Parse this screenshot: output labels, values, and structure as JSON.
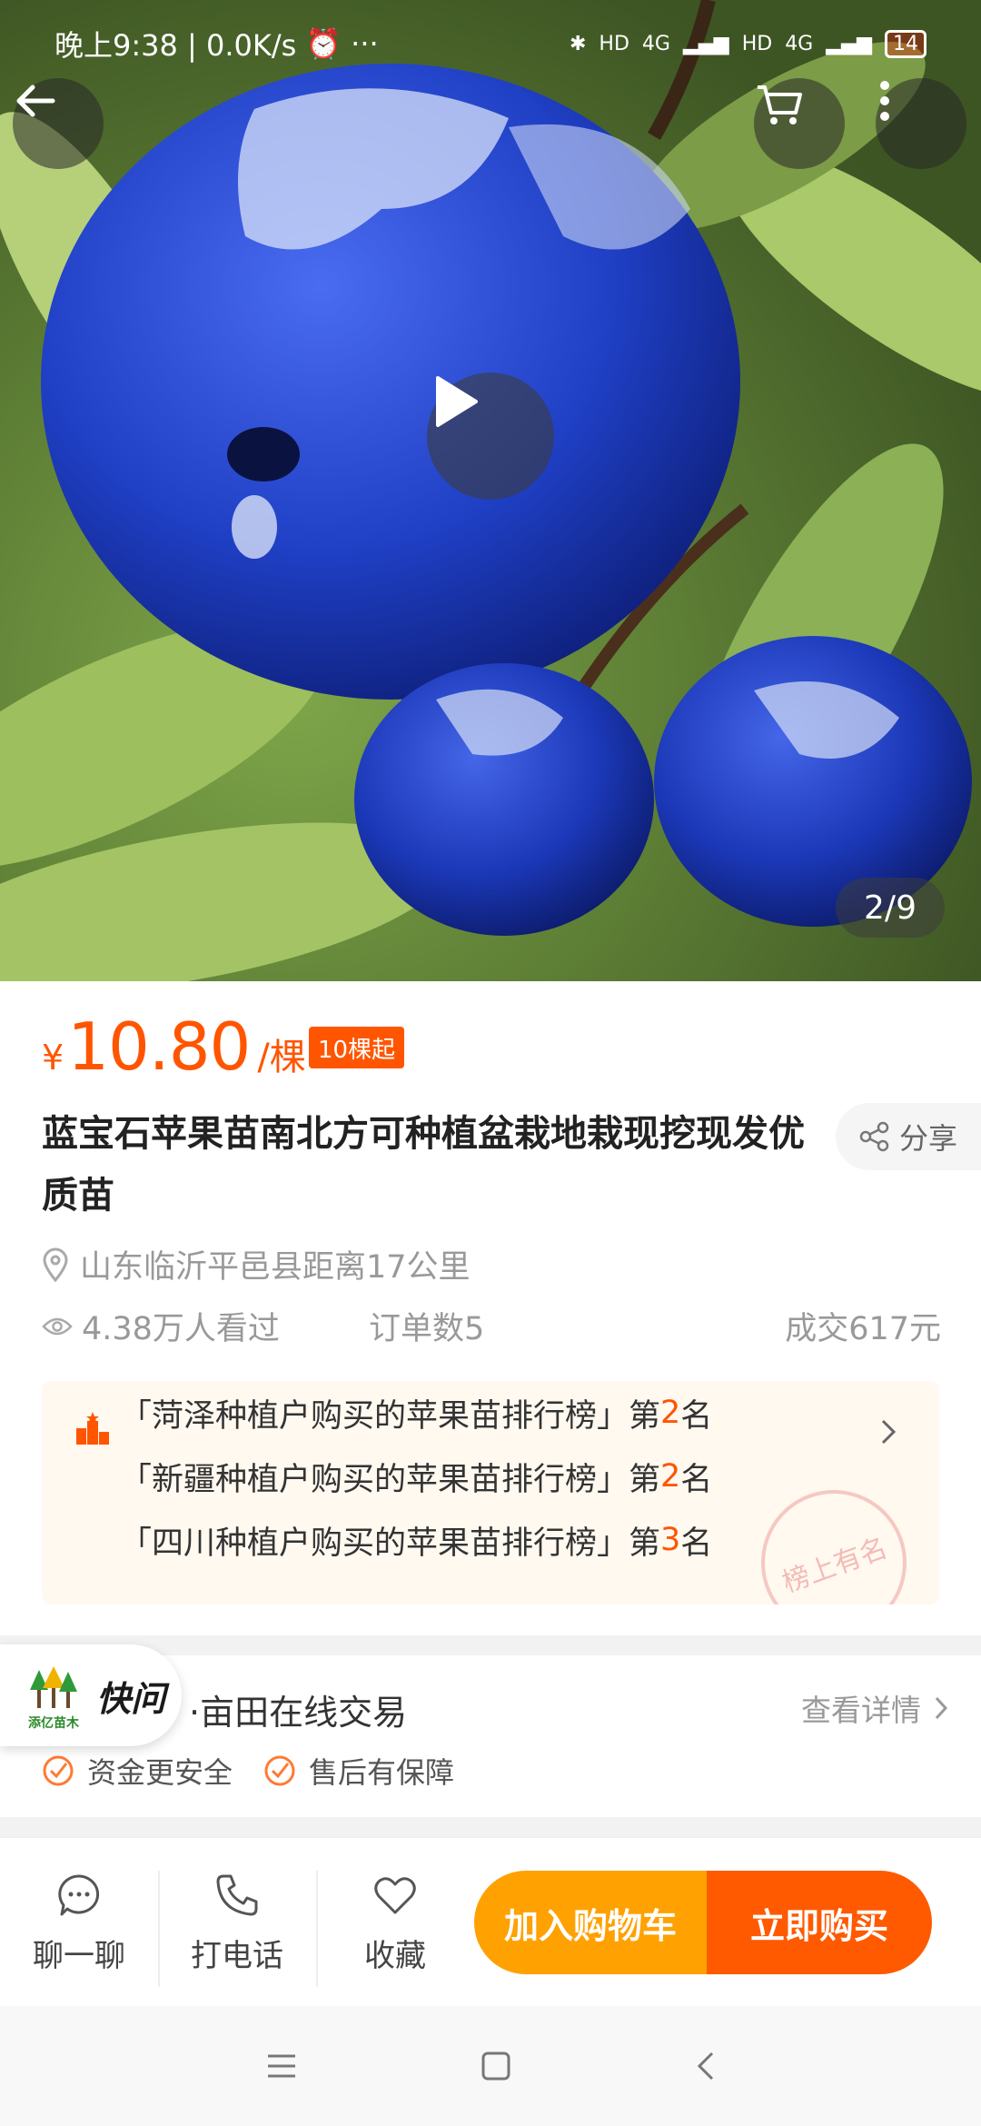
{
  "status_bar": {
    "time": "晚上9:38 | 0.0K/s",
    "alarm_icon": "alarm-icon",
    "more_dots": "···",
    "network_hd1": "HD",
    "network_4g1": "4G",
    "network_hd2": "HD",
    "network_4g2": "4G",
    "battery": "14"
  },
  "hero": {
    "page_counter": "2/9",
    "back_icon": "back-arrow-icon",
    "cart_icon": "cart-icon",
    "more_icon": "more-vertical-icon",
    "play_icon": "play-icon"
  },
  "price": {
    "currency": "¥",
    "amount": "10.80",
    "unit": "/棵",
    "min_order_badge": "10棵起"
  },
  "product": {
    "title": "蓝宝石苹果苗南北方可种植盆栽地栽现挖现发优质苗",
    "share_label": "分享",
    "location": "山东临沂平邑县距离17公里",
    "views": "4.38万人看过",
    "orders": "订单数5",
    "deal": "成交617元"
  },
  "rankings": {
    "items": [
      {
        "prefix": "「菏泽种植户购买的苹果苗排行榜」第",
        "rank": "2",
        "suffix": "名"
      },
      {
        "prefix": "「新疆种植户购买的苹果苗排行榜」第",
        "rank": "2",
        "suffix": "名"
      },
      {
        "prefix": "「四川种植户购买的苹果苗排行榜」第",
        "rank": "3",
        "suffix": "名"
      }
    ],
    "stamp_text": "榜上有名"
  },
  "trade": {
    "kuaiwen_label": "快问",
    "logo_text": "添亿苗木",
    "title": "·亩田在线交易",
    "more": "查看详情",
    "guarantees": [
      "资金更安全",
      "售后有保障"
    ]
  },
  "bottom_bar": {
    "chat": "聊一聊",
    "call": "打电话",
    "favorite": "收藏",
    "add_to_cart": "加入购物车",
    "buy_now": "立即购买"
  },
  "colors": {
    "accent": "#ff5500",
    "cart_button": "#ffa100",
    "buy_button": "#ff5a00",
    "fruit_blue": "#1f3fc4"
  }
}
